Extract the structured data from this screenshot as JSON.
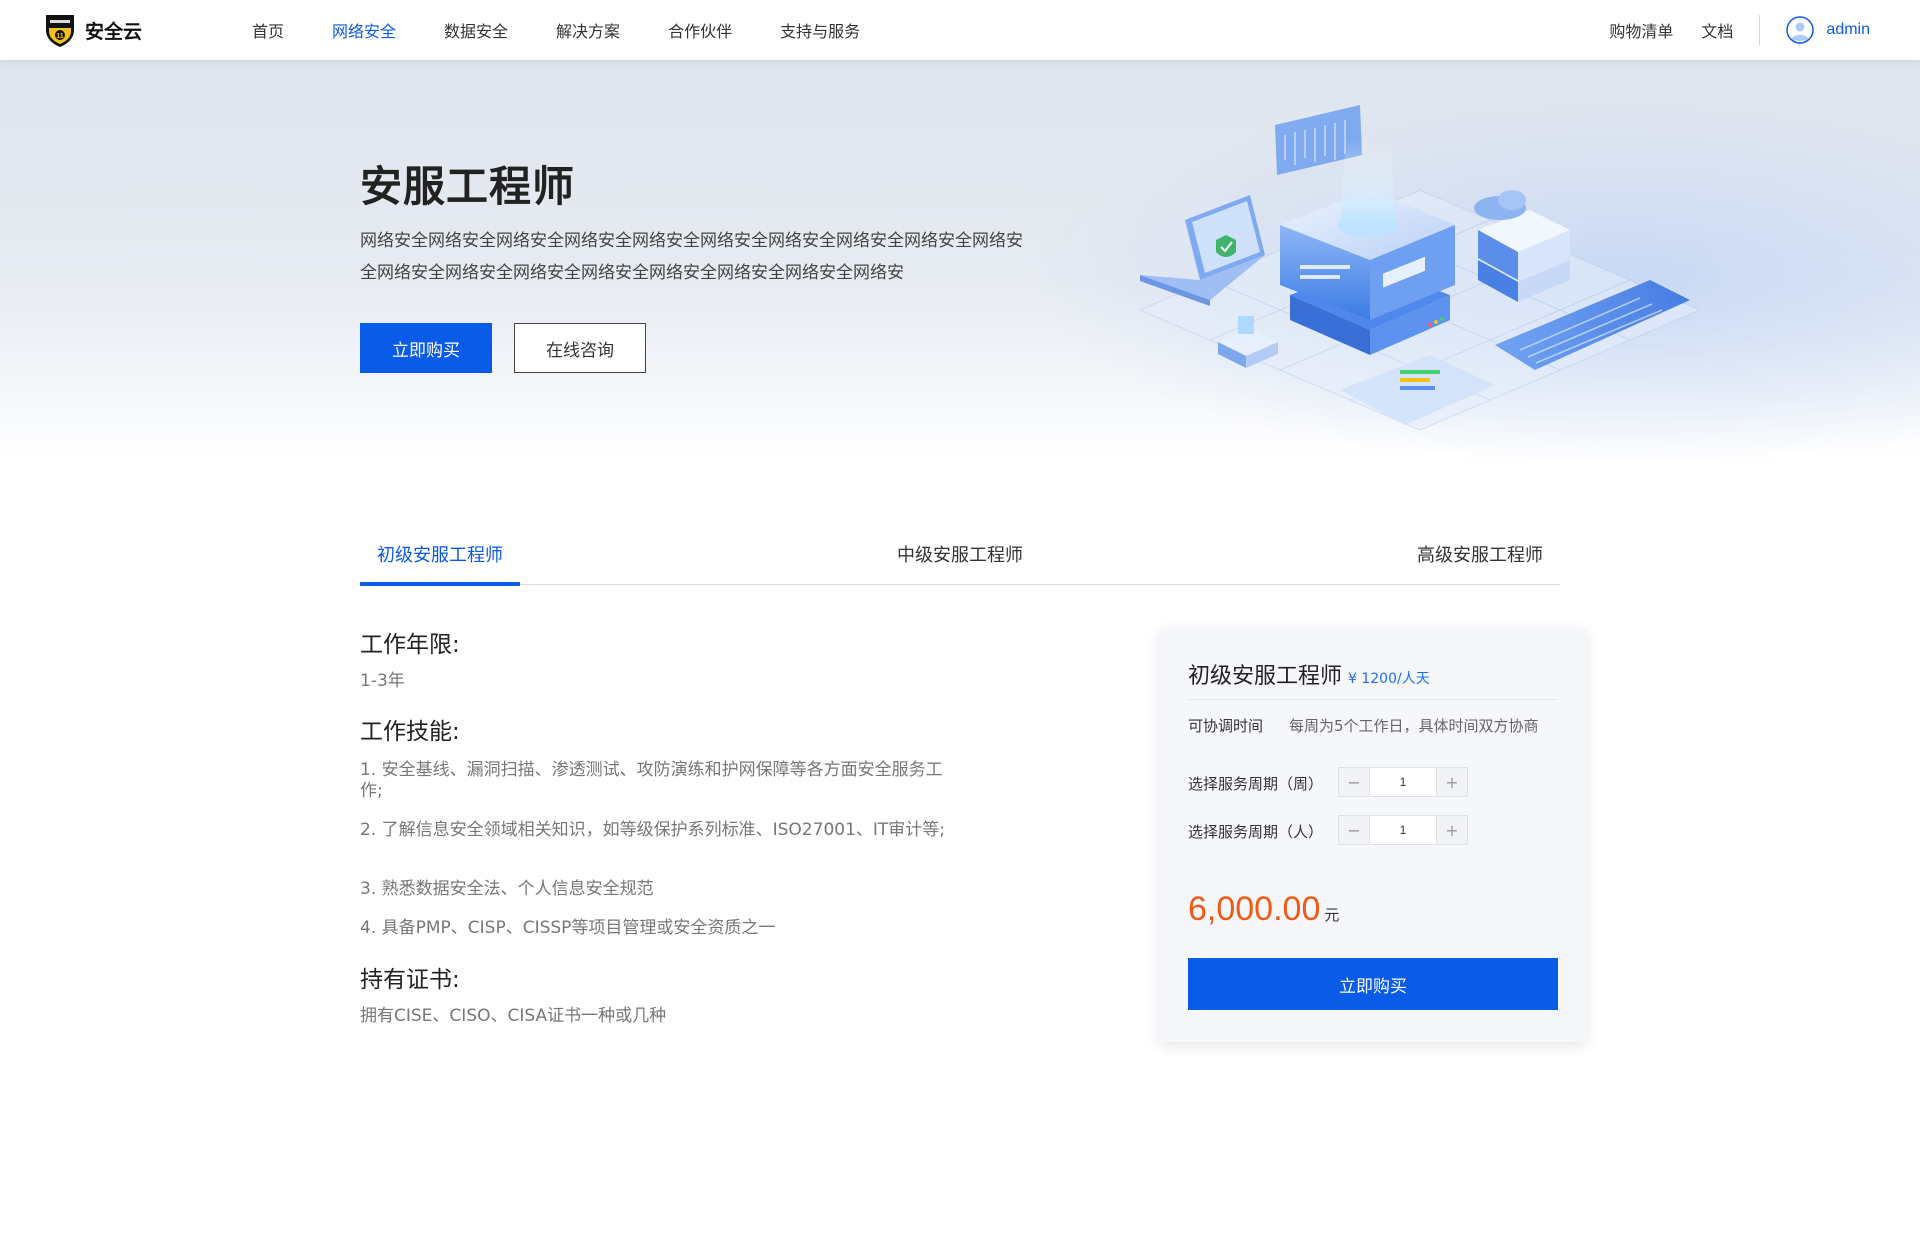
{
  "header": {
    "logo_text": "安全云",
    "nav": [
      {
        "label": "首页",
        "active": false
      },
      {
        "label": "网络安全",
        "active": true
      },
      {
        "label": "数据安全",
        "active": false
      },
      {
        "label": "解决方案",
        "active": false
      },
      {
        "label": "合作伙伴",
        "active": false
      },
      {
        "label": "支持与服务",
        "active": false
      }
    ],
    "cart_label": "购物清单",
    "docs_label": "文档",
    "username": "admin"
  },
  "hero": {
    "title": "安服工程师",
    "description": "网络安全网络安全网络安全网络安全网络安全网络安全网络安全网络安全网络安全网络安全网络安全网络安全网络安全网络安全网络安全网络安全网络安全网络安",
    "buy_label": "立即购买",
    "consult_label": "在线咨询"
  },
  "tabs": [
    {
      "label": "初级安服工程师",
      "active": true
    },
    {
      "label": "中级安服工程师",
      "active": false
    },
    {
      "label": "高级安服工程师",
      "active": false
    }
  ],
  "details": {
    "years_title": "工作年限:",
    "years_value": "1-3年",
    "skills_title": "工作技能:",
    "skills": [
      "1. 安全基线、漏洞扫描、渗透测试、攻防演练和护网保障等各方面安全服务工作;",
      "2. 了解信息安全领域相关知识，如等级保护系列标准、ISO27001、IT审计等;",
      "3. 熟悉数据安全法、个人信息安全规范",
      "4. 具备PMP、CISP、CISSP等项目管理或安全资质之一"
    ],
    "cert_title": "持有证书:",
    "cert_value": "拥有CISE、CISO、CISA证书一种或几种"
  },
  "card": {
    "title": "初级安服工程师",
    "unit_price": "¥ 1200/人天",
    "time_label": "可协调时间",
    "time_value": "每周为5个工作日，具体时间双方协商",
    "week_label": "选择服务周期（周）",
    "week_value": "1",
    "people_label": "选择服务周期（人）",
    "people_value": "1",
    "minus": "−",
    "plus": "+",
    "total_amount": "6,000.00",
    "total_unit": "元",
    "buy_label": "立即购买"
  },
  "colors": {
    "accent": "#0a5ce8",
    "price": "#f05a14"
  }
}
